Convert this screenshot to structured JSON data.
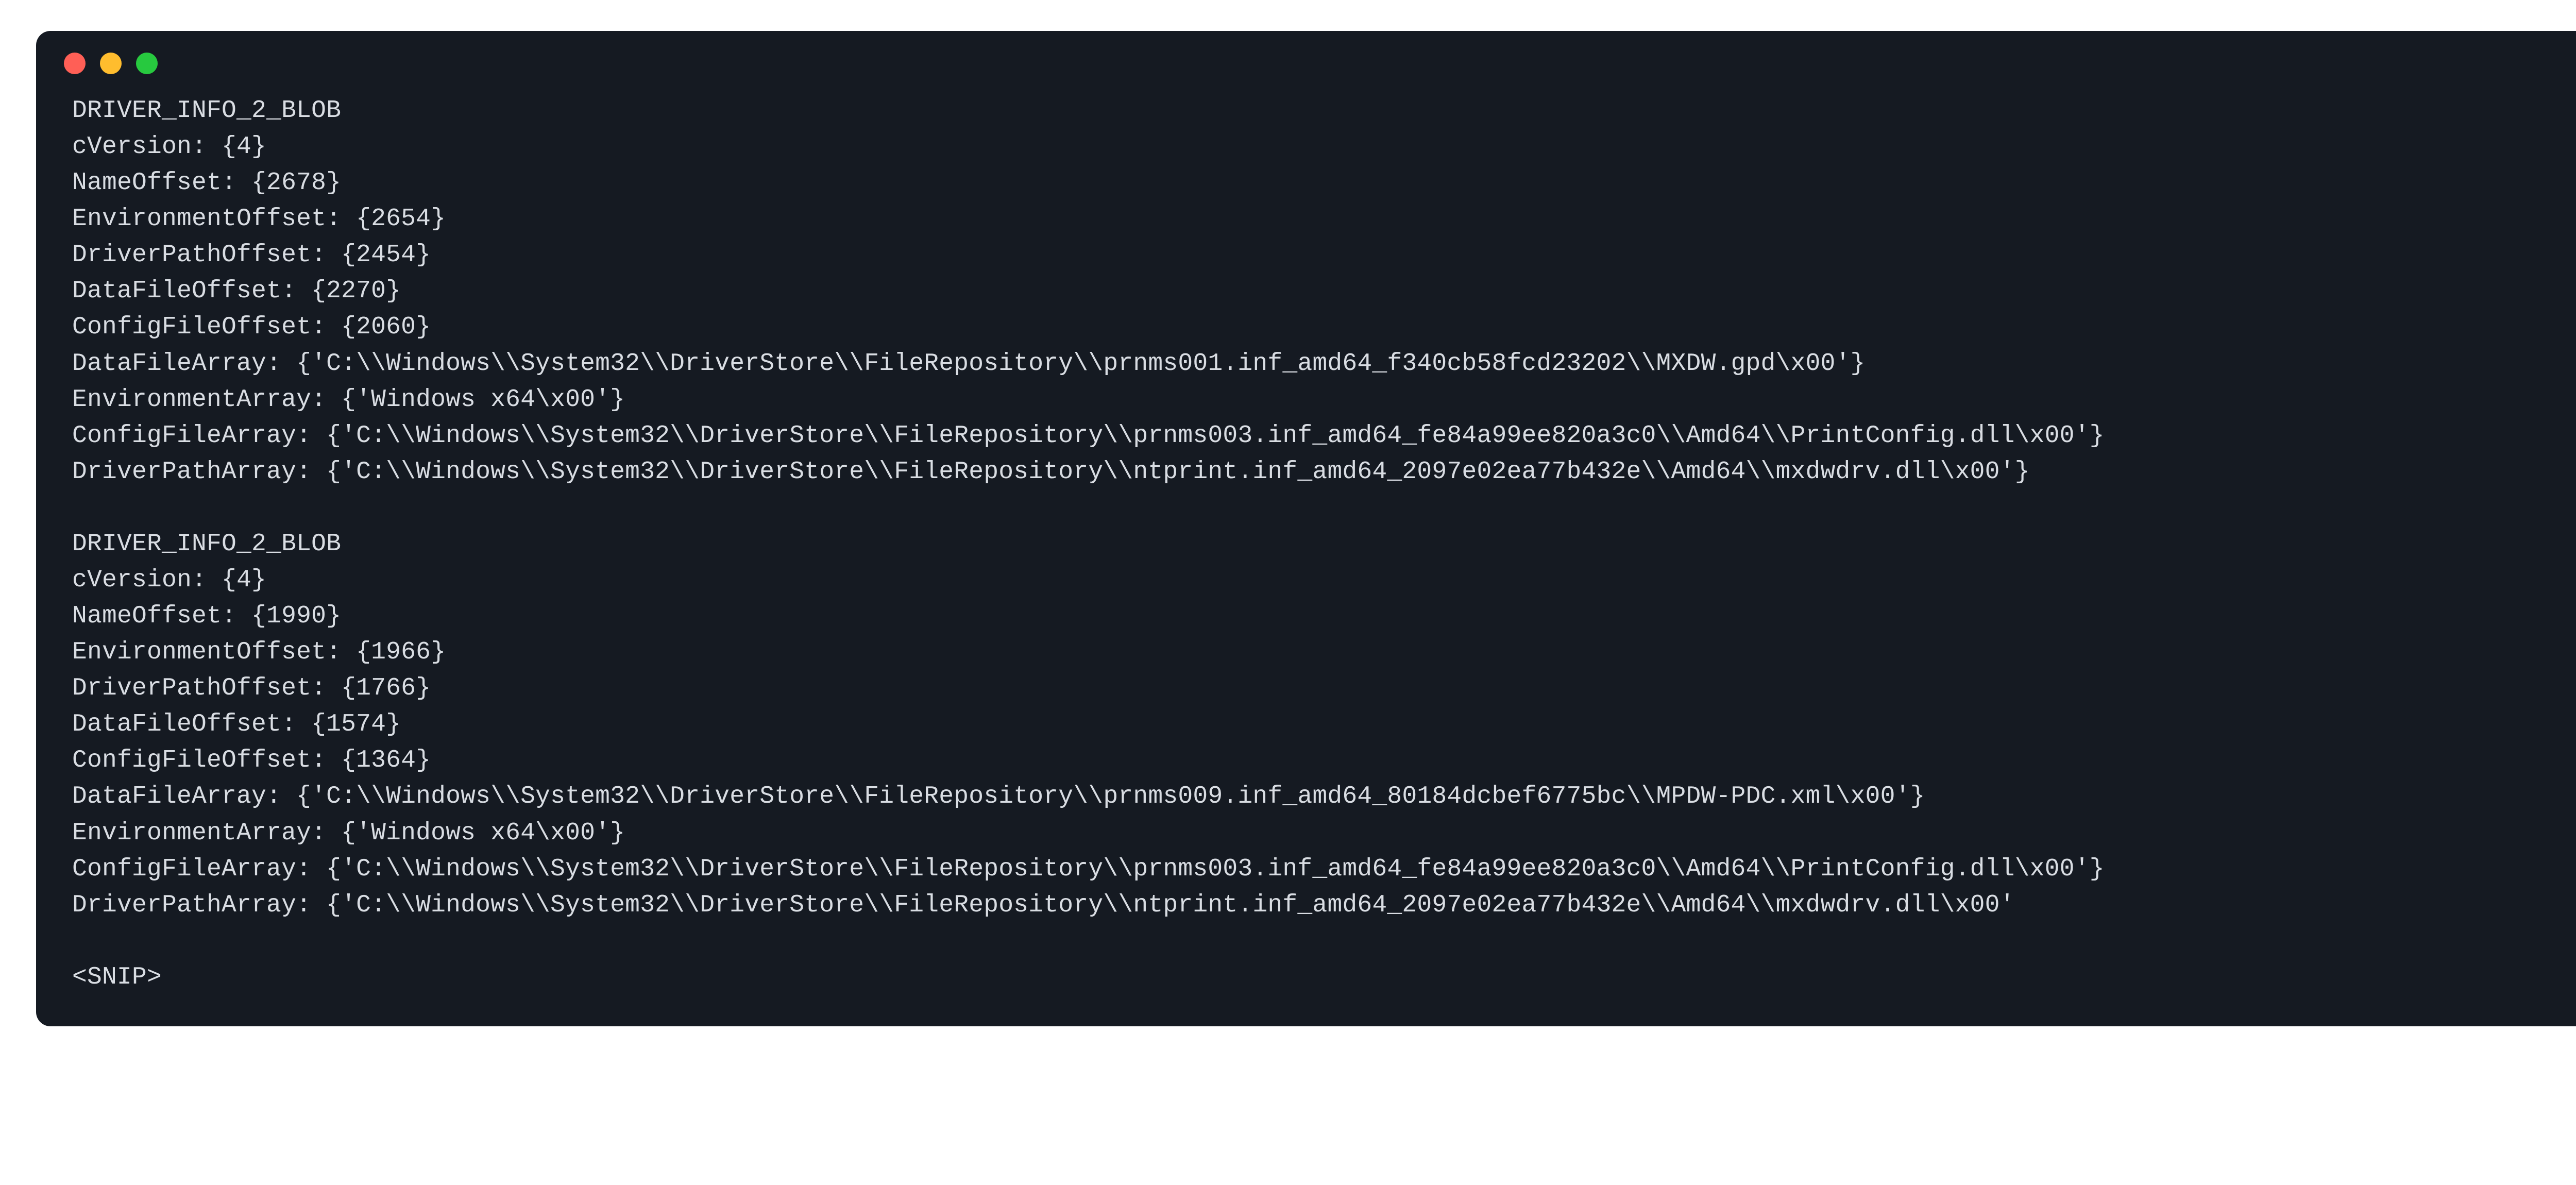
{
  "window": {
    "traffic_lights": [
      "close",
      "minimize",
      "zoom"
    ]
  },
  "blobs": [
    {
      "title": "DRIVER_INFO_2_BLOB",
      "cVersion": "{4}",
      "NameOffset": "{2678}",
      "EnvironmentOffset": "{2654}",
      "DriverPathOffset": "{2454}",
      "DataFileOffset": "{2270}",
      "ConfigFileOffset": "{2060}",
      "DataFileArray": "{'C:\\\\Windows\\\\System32\\\\DriverStore\\\\FileRepository\\\\prnms001.inf_amd64_f340cb58fcd23202\\\\MXDW.gpd\\x00'}",
      "EnvironmentArray": "{'Windows x64\\x00'}",
      "ConfigFileArray": "{'C:\\\\Windows\\\\System32\\\\DriverStore\\\\FileRepository\\\\prnms003.inf_amd64_fe84a99ee820a3c0\\\\Amd64\\\\PrintConfig.dll\\x00'}",
      "DriverPathArray": "{'C:\\\\Windows\\\\System32\\\\DriverStore\\\\FileRepository\\\\ntprint.inf_amd64_2097e02ea77b432e\\\\Amd64\\\\mxdwdrv.dll\\x00'}"
    },
    {
      "title": "DRIVER_INFO_2_BLOB",
      "cVersion": "{4}",
      "NameOffset": "{1990}",
      "EnvironmentOffset": "{1966}",
      "DriverPathOffset": "{1766}",
      "DataFileOffset": "{1574}",
      "ConfigFileOffset": "{1364}",
      "DataFileArray": "{'C:\\\\Windows\\\\System32\\\\DriverStore\\\\FileRepository\\\\prnms009.inf_amd64_80184dcbef6775bc\\\\MPDW-PDC.xml\\x00'}",
      "EnvironmentArray": "{'Windows x64\\x00'}",
      "ConfigFileArray": "{'C:\\\\Windows\\\\System32\\\\DriverStore\\\\FileRepository\\\\prnms003.inf_amd64_fe84a99ee820a3c0\\\\Amd64\\\\PrintConfig.dll\\x00'}",
      "DriverPathArray": "{'C:\\\\Windows\\\\System32\\\\DriverStore\\\\FileRepository\\\\ntprint.inf_amd64_2097e02ea77b432e\\\\Amd64\\\\mxdwdrv.dll\\x00'"
    }
  ],
  "snip": "<SNIP>",
  "field_order": [
    "cVersion",
    "NameOffset",
    "EnvironmentOffset",
    "DriverPathOffset",
    "DataFileOffset",
    "ConfigFileOffset",
    "DataFileArray",
    "EnvironmentArray",
    "ConfigFileArray",
    "DriverPathArray"
  ]
}
